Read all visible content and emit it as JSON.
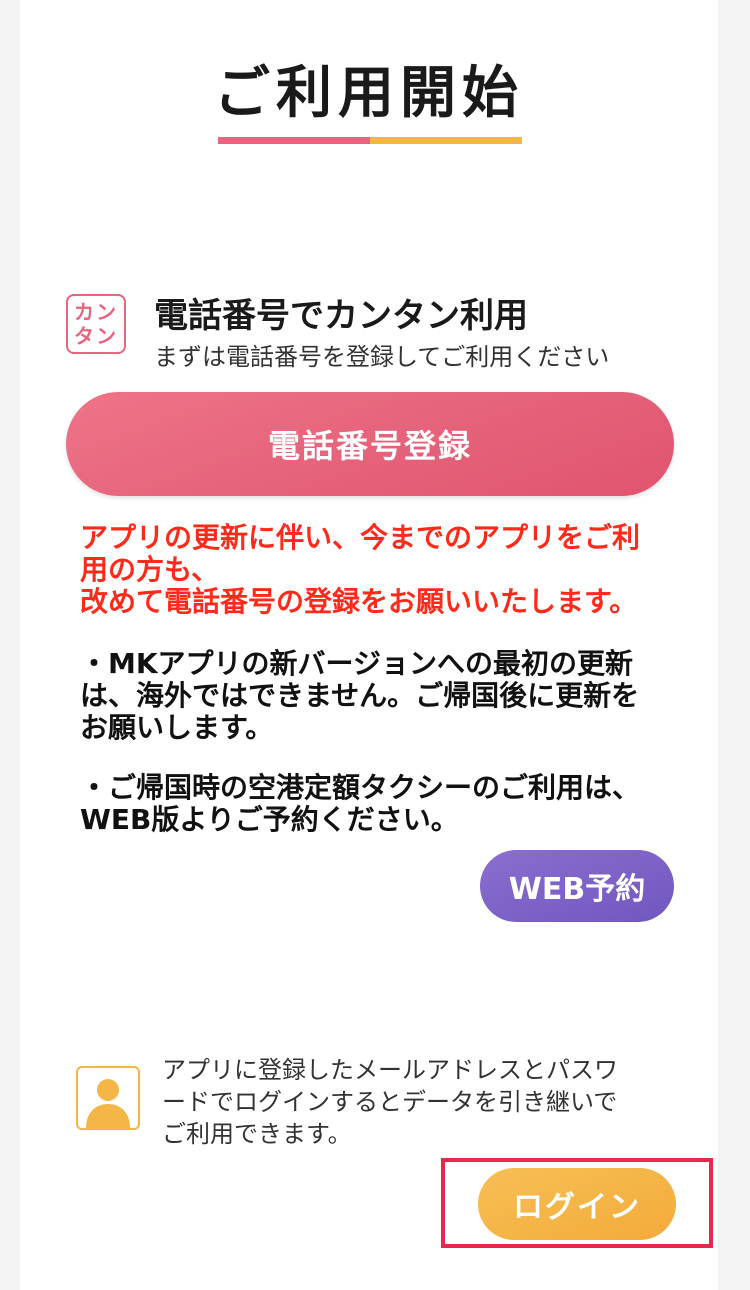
{
  "header": {
    "title": "ご利用開始"
  },
  "phone_section": {
    "icon_line1": "カン",
    "icon_line2": "タン",
    "title": "電話番号でカンタン利用",
    "subtitle": "まずは電話番号を登録してご利用ください",
    "register_button": "電話番号登録"
  },
  "notice_red": {
    "line1": "アプリの更新に伴い、今までのアプリをご利",
    "line2": "用の方も、",
    "line3": "改めて電話番号の登録をお願いいたします。"
  },
  "notice_update": {
    "line1": "・MKアプリの新バージョンへの最初の更新",
    "line2": "は、海外ではできません。ご帰国後に更新を",
    "line3": "お願いします。"
  },
  "notice_airport": {
    "line1": "・ご帰国時の空港定額タクシーのご利用は、",
    "line2": "WEB版よりご予約ください。"
  },
  "web_button": "WEB予約",
  "login_section": {
    "icon": "user-silhouette-icon",
    "desc_line1": "アプリに登録したメールアドレスとパスワ",
    "desc_line2": "ードでログインするとデータを引き継いで",
    "desc_line3": "ご利用できます。",
    "login_button": "ログイン"
  },
  "colors": {
    "accent_pink": "#e8657e",
    "accent_yellow": "#f5b648",
    "notice_red": "#ff2a1a",
    "web_purple": "#7156c0",
    "highlight": "#e8284e"
  }
}
